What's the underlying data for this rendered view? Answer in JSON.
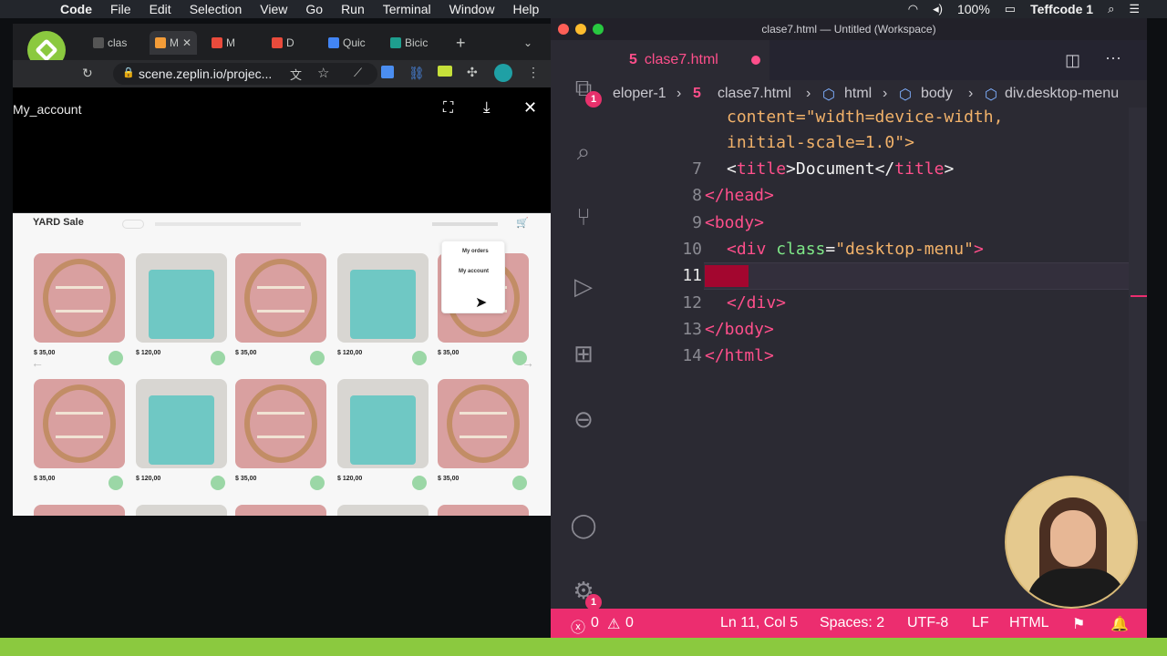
{
  "menubar": {
    "app": "Code",
    "items": [
      "File",
      "Edit",
      "Selection",
      "View",
      "Go",
      "Run",
      "Terminal",
      "Window",
      "Help"
    ],
    "battery": "100%",
    "user": "Teffcode 1"
  },
  "browser": {
    "tabs": [
      "clas",
      "M",
      "M",
      "D",
      "Quic",
      "Bicic"
    ],
    "url": "scene.zeplin.io/projec...",
    "viewer_title": "My_account"
  },
  "design": {
    "brand": "YARD Sale",
    "dropdown": [
      "My orders",
      "My account"
    ],
    "prices": [
      "$ 35,00",
      "$ 120,00",
      "$ 35,00",
      "$ 120,00",
      "$ 35,00"
    ]
  },
  "vscode": {
    "window_title": "clase7.html — Untitled (Workspace)",
    "tab": "clase7.html",
    "breadcrumbs": [
      "eloper-1",
      "clase7.html",
      "html",
      "body",
      "div.desktop-menu"
    ],
    "code_top": [
      "content=\"width=device-width,",
      "initial-scale=1.0\">"
    ],
    "lines": [
      {
        "n": "7",
        "indent": "    "
      },
      {
        "n": "8",
        "indent": "  "
      },
      {
        "n": "9",
        "indent": "  "
      },
      {
        "n": "10",
        "indent": "    "
      },
      {
        "n": "11",
        "indent": ""
      },
      {
        "n": "12",
        "indent": "    "
      },
      {
        "n": "13",
        "indent": "  "
      },
      {
        "n": "14",
        "indent": "  "
      }
    ],
    "code": {
      "l7_a": "<",
      "l7_tag": "title",
      "l7_b": ">",
      "l7_text": "Document",
      "l7_c": "</",
      "l7_tag2": "title",
      "l7_d": ">",
      "l8": "</head>",
      "l9": "<body>",
      "l10_open": "<div ",
      "l10_attr": "class",
      "l10_eq": "=",
      "l10_val": "\"desktop-menu\"",
      "l10_close": ">",
      "l12": "</div>",
      "l13": "</body>",
      "l14": "</html>"
    },
    "badges": {
      "explorer": "1",
      "settings": "1"
    },
    "status": {
      "errors": "0",
      "warnings": "0",
      "position": "Ln 11, Col 5",
      "spaces": "Spaces: 2",
      "encoding": "UTF-8",
      "eol": "LF",
      "language": "HTML"
    }
  },
  "colors": {
    "accent": "#ec2d6f",
    "tag": "#ff4f8b",
    "string": "#f2b26a"
  }
}
